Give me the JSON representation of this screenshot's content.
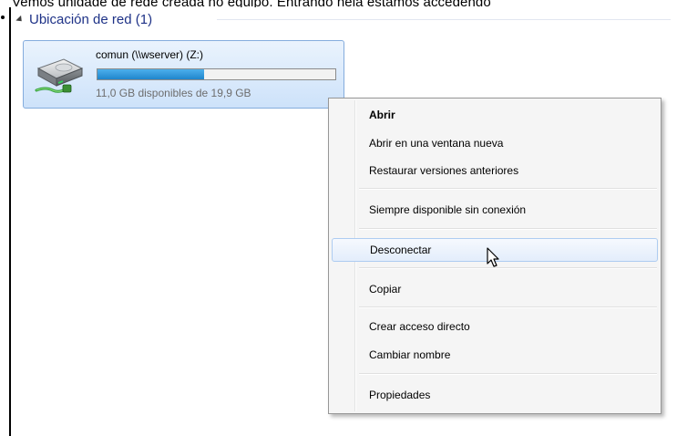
{
  "caption": {
    "text": "Vemos unidade de rede creada no equipo. Entrando nela estamos accedendo"
  },
  "group": {
    "label": "Ubicación de red (1)"
  },
  "drive": {
    "name": "comun (\\\\wserver) (Z:)",
    "free_text": "11,0 GB disponibles de 19,9 GB",
    "icon": "network-drive-icon",
    "used_fraction": 0.45
  },
  "context_menu": {
    "items": [
      {
        "label": "Abrir",
        "bold": true
      },
      {
        "label": "Abrir en una ventana nueva"
      },
      {
        "label": "Restaurar versiones anteriores"
      },
      {
        "label": "Siempre disponible sin conexión"
      },
      {
        "label": "Desconectar",
        "highlighted": true
      },
      {
        "label": "Copiar"
      },
      {
        "label": "Crear acceso directo"
      },
      {
        "label": "Cambiar nombre"
      },
      {
        "label": "Propiedades"
      }
    ]
  },
  "cursor": {
    "icon": "mouse-pointer-icon"
  },
  "colors": {
    "group_header_text": "#1e3287",
    "selection_border": "#84acdd",
    "capacity_fill": "#1f85cc",
    "menu_background": "#f5f5f5",
    "menu_highlight_border": "#aeccf1"
  }
}
